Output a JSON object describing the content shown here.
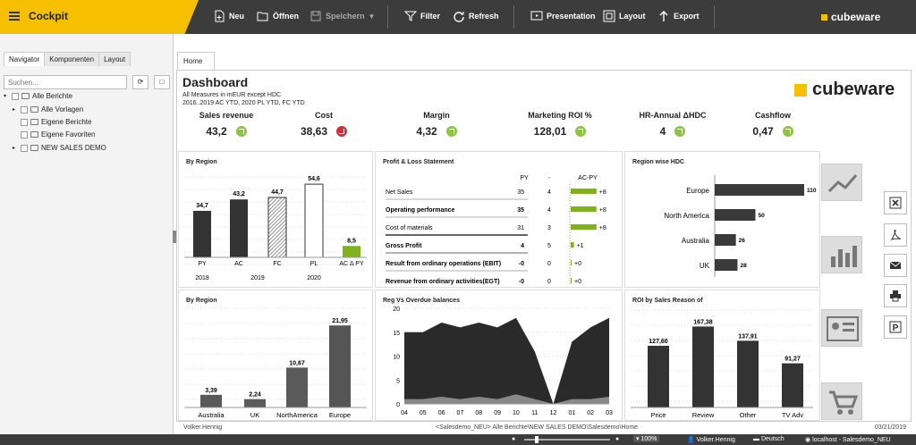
{
  "app": {
    "title": "Cockpit",
    "brand": "cubeware"
  },
  "toolbar": [
    {
      "label": "Neu",
      "icon": "new-doc-icon",
      "enabled": true
    },
    {
      "label": "Öffnen",
      "icon": "folder-open-icon",
      "enabled": true
    },
    {
      "label": "Speichern",
      "icon": "save-icon",
      "enabled": false
    },
    {
      "label": "Filter",
      "icon": "filter-icon",
      "enabled": true
    },
    {
      "label": "Refresh",
      "icon": "refresh-icon",
      "enabled": true
    },
    {
      "label": "Presentation",
      "icon": "presentation-icon",
      "enabled": true
    },
    {
      "label": "Layout",
      "icon": "layout-icon",
      "enabled": true
    },
    {
      "label": "Export",
      "icon": "export-icon",
      "enabled": true
    }
  ],
  "left_panel": {
    "tabs": [
      "Navigator",
      "Komponenten",
      "Layout"
    ],
    "search_placeholder": "Suchen...",
    "tree": [
      {
        "label": "Alle Berichte",
        "level": 0,
        "arrow": "▾"
      },
      {
        "label": "Alle Vorlagen",
        "level": 1,
        "arrow": "▸"
      },
      {
        "label": "Eigene Berichte",
        "level": 1,
        "arrow": ""
      },
      {
        "label": "Eigene Favoriten",
        "level": 1,
        "arrow": ""
      },
      {
        "label": "NEW SALES DEMO",
        "level": 1,
        "arrow": "▸"
      }
    ]
  },
  "main_tab": "Home",
  "dashboard": {
    "title": "Dashboard",
    "subtitle1": "All Measures in mEUR except HDC",
    "subtitle2": "2016..2019 AC YTD, 2020 PL YTD, FC YTD",
    "logo_text": "cubeware"
  },
  "kpis": [
    {
      "label": "Sales revenue",
      "value": "43,2",
      "trend": "up"
    },
    {
      "label": "Cost",
      "value": "38,63",
      "trend": "down"
    },
    {
      "label": "Margin",
      "value": "4,32",
      "trend": "up"
    },
    {
      "label": "Marketing ROI %",
      "value": "128,01",
      "trend": "up"
    },
    {
      "label": "HR-Annual ΔHDC",
      "value": "4",
      "trend": "up"
    },
    {
      "label": "Cashflow",
      "value": "0,47",
      "trend": "up"
    }
  ],
  "chart_data": [
    {
      "type": "bar",
      "title": "By Region",
      "categories": [
        "PY",
        "AC",
        "FC",
        "PL",
        "AC Δ PY"
      ],
      "values": [
        34.7,
        43.2,
        44.7,
        54.6,
        8.5
      ],
      "value_labels": [
        "34,7",
        "43,2",
        "44,7",
        "54,6",
        "8,5"
      ],
      "group_labels": [
        "2018",
        "2019",
        "2020"
      ],
      "colors": [
        "#333333",
        "#333333",
        "hatch",
        "outline",
        "#7fb21c"
      ]
    },
    {
      "type": "table",
      "title": "Profit & Loss Statement",
      "columns": [
        "PY",
        "-",
        "AC-PY"
      ],
      "rows": [
        {
          "label": "Net Sales",
          "py": "35",
          "ac": "4",
          "delta": 8,
          "delta_label": "+8"
        },
        {
          "label": "Operating performance",
          "py": "35",
          "ac": "4",
          "delta": 8,
          "delta_label": "+8"
        },
        {
          "label": "Cost of materials",
          "py": "31",
          "ac": "3",
          "delta": 8,
          "delta_label": "+8"
        },
        {
          "label": "Gross Profit",
          "py": "4",
          "ac": "5",
          "delta": 1,
          "delta_label": "+1"
        },
        {
          "label": "Result from ordinary operations (EBIT)",
          "py": "-0",
          "ac": "0",
          "delta": 0,
          "delta_label": "+0"
        },
        {
          "label": "Revenue from ordinary activities(EGT)",
          "py": "-0",
          "ac": "0",
          "delta": 0,
          "delta_label": "+0"
        }
      ]
    },
    {
      "type": "bar",
      "title": "Region wise HDC",
      "orientation": "horizontal",
      "categories": [
        "Europe",
        "North America",
        "Australia",
        "UK"
      ],
      "values": [
        110,
        50,
        26,
        28
      ]
    },
    {
      "type": "bar",
      "title": "By Region",
      "categories": [
        "Australia",
        "UK",
        "NorthAmerica",
        "Europe"
      ],
      "values": [
        3.39,
        2.24,
        10.67,
        21.95
      ],
      "value_labels": [
        "3,39",
        "2,24",
        "10,67",
        "21,95"
      ]
    },
    {
      "type": "area",
      "title": "Reg Vs Overdue balances",
      "x": [
        "04",
        "05",
        "06",
        "07",
        "08",
        "09",
        "10",
        "11",
        "12",
        "01",
        "02",
        "03"
      ],
      "series": [
        {
          "values": [
            15,
            15,
            17,
            16,
            17,
            16,
            18,
            11,
            0,
            13,
            16,
            18
          ]
        },
        {
          "values": [
            1,
            1,
            1.5,
            1,
            1.5,
            1,
            2,
            1,
            0,
            1,
            1,
            1.5
          ]
        }
      ],
      "ylim": [
        0,
        20
      ],
      "yticks": [
        0,
        5,
        10,
        15,
        20
      ]
    },
    {
      "type": "bar",
      "title": "ROI by Sales Reason of",
      "categories": [
        "Price",
        "Review",
        "Other",
        "TV Adv"
      ],
      "values": [
        127.6,
        167.38,
        137.91,
        91.27
      ],
      "value_labels": [
        "127,60",
        "167,38",
        "137,91",
        "91,27"
      ]
    }
  ],
  "footer": {
    "left": "Volker.Hennig",
    "center": "<Salesdemo_NEU> Alle Berichte\\NEW SALES DEMO\\Salesdemo\\Home",
    "right": "03/21/2019"
  },
  "status": {
    "zoom": "100%",
    "user": "Volker.Hennig",
    "language": "Deutsch",
    "server": "localhost - Salesdemo_NEU"
  }
}
